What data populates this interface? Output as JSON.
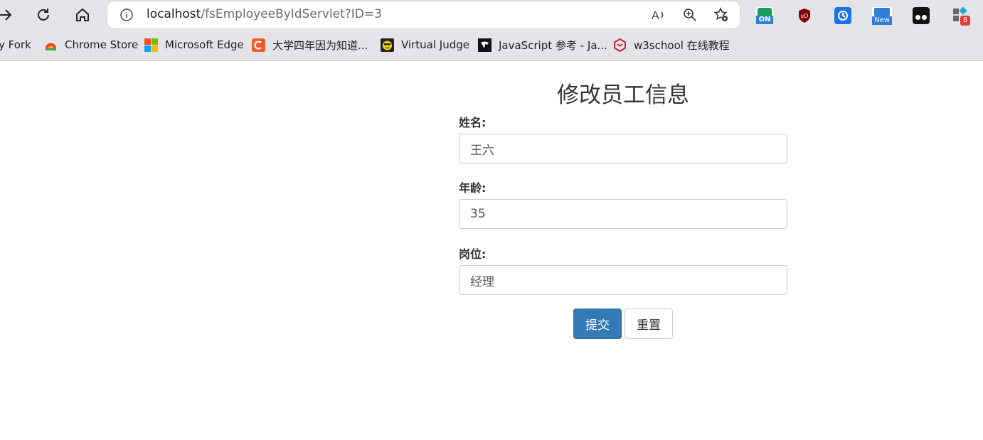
{
  "browser": {
    "url_host": "localhost",
    "url_path": "/fsEmployeeByIdServlet?ID=3",
    "extensions": [
      {
        "icon": "on-extension-icon",
        "badge": "ON",
        "color": "#1e9b55"
      },
      {
        "icon": "ublock-icon",
        "badge": "",
        "color": "#8b0000"
      },
      {
        "icon": "history-extension-icon",
        "badge": "",
        "color": "#1a73e8"
      },
      {
        "icon": "new-extension-icon",
        "badge": "New",
        "color": "#2f7fd8"
      },
      {
        "icon": "tampermonkey-icon",
        "badge": "",
        "color": "#111111"
      },
      {
        "icon": "extensions-icon",
        "badge": "8",
        "color": "#666666"
      }
    ],
    "bookmarks": [
      {
        "label": "y Fork",
        "icon": ""
      },
      {
        "label": "Chrome Store",
        "icon": "chrome-store-icon"
      },
      {
        "label": "Microsoft Edge",
        "icon": "microsoft-icon"
      },
      {
        "label": "大学四年因为知道...",
        "icon": "c-icon"
      },
      {
        "label": "Virtual Judge",
        "icon": "virtual-judge-icon"
      },
      {
        "label": "JavaScript 参考 - Ja...",
        "icon": "mdn-icon"
      },
      {
        "label": "w3school 在线教程",
        "icon": "w3school-icon"
      }
    ]
  },
  "form": {
    "title": "修改员工信息",
    "name_label": "姓名:",
    "name_value": "王六",
    "age_label": "年龄:",
    "age_value": "35",
    "position_label": "岗位:",
    "position_value": "经理",
    "submit_label": "提交",
    "reset_label": "重置"
  },
  "colors": {
    "primary": "#337ab7",
    "browser_chrome": "#e3e4e8"
  }
}
